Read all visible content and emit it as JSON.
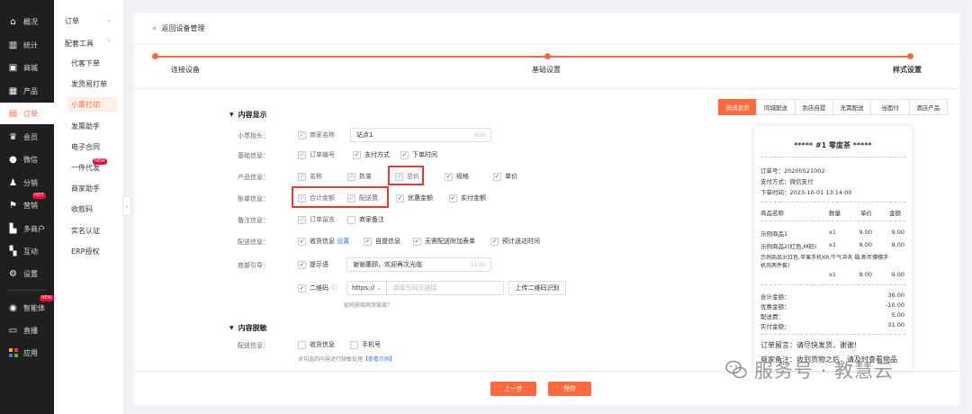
{
  "nav": {
    "items": [
      {
        "label": "概况",
        "icon": "home-icon"
      },
      {
        "label": "统计",
        "icon": "chart-icon"
      },
      {
        "label": "商城",
        "icon": "shop-icon"
      },
      {
        "label": "产品",
        "icon": "grid-icon"
      },
      {
        "label": "订单",
        "icon": "order-icon",
        "active": true
      },
      {
        "label": "会员",
        "icon": "crown-icon"
      },
      {
        "label": "微信",
        "icon": "wechat-icon"
      },
      {
        "label": "分销",
        "icon": "user-share-icon"
      },
      {
        "label": "营销",
        "icon": "flag-icon",
        "badge": "HOT"
      },
      {
        "label": "多商户",
        "icon": "store-icon"
      },
      {
        "label": "互动",
        "icon": "interaction-icon"
      },
      {
        "label": "设置",
        "icon": "gear-icon"
      },
      {
        "label": "智能体",
        "icon": "robot-icon",
        "badge": "NEW"
      },
      {
        "label": "直播",
        "icon": "tv-icon"
      },
      {
        "label": "应用",
        "icon": "apps-icon"
      }
    ]
  },
  "subnav": {
    "group_order": "订单",
    "group_tools": "配套工具",
    "items": [
      {
        "label": "代客下单"
      },
      {
        "label": "发货易打单"
      },
      {
        "label": "小票打印",
        "active": true
      },
      {
        "label": "发票助手"
      },
      {
        "label": "电子合同"
      },
      {
        "label": "一件代发",
        "badge": "NEW"
      },
      {
        "label": "商家助手"
      },
      {
        "label": "收款码"
      },
      {
        "label": "实名认证"
      },
      {
        "label": "ERP授权"
      }
    ]
  },
  "header": {
    "back_label": "返回设备管理"
  },
  "steps": [
    "连接设备",
    "基础设置",
    "样式设置"
  ],
  "form": {
    "section_display": "内容显示",
    "section_mask": "内容脱敏",
    "ticket_header": {
      "label": "小票抬头：",
      "checkbox": "商家名称",
      "value": "站点1",
      "count": "3/30"
    },
    "basic": {
      "label": "基础信息：",
      "items": [
        "订单编号",
        "支付方式",
        "下单时间"
      ]
    },
    "product": {
      "label": "产品信息：",
      "items": [
        "名称",
        "数量",
        "总价",
        "规格",
        "单价"
      ]
    },
    "bill": {
      "label": "账单信息：",
      "items": [
        "合计金额",
        "配送费",
        "优惠金额",
        "实付金额"
      ]
    },
    "remark": {
      "label": "备注信息：",
      "items": [
        "订单留言",
        "商家备注"
      ]
    },
    "delivery": {
      "label": "配送信息：",
      "items": [
        "收货信息",
        "自提信息",
        "无需配送附加表单",
        "预计送达时间"
      ],
      "settings_link": "设置"
    },
    "footer": {
      "label": "底部引导：",
      "prompt_checkbox": "提示语",
      "prompt_value": "谢谢惠顾，欢迎再次光临",
      "prompt_count": "11/20",
      "qr_checkbox": "二维码",
      "protocol": "https://",
      "url_placeholder": "请填写网页链接",
      "upload_btn": "上传二维码识别",
      "howto_link": "如何获取网页链接？"
    },
    "mask": {
      "label": "配送信息：",
      "items": [
        "收货信息",
        "手机号"
      ],
      "hint": "对勾选的内容进行脱敏处理",
      "example_link": "【查看示例】"
    }
  },
  "buttons": {
    "prev": "上一步",
    "save": "保存"
  },
  "preview": {
    "tabs": [
      "快递发货",
      "同城配送",
      "到店自提",
      "无需配送",
      "当面付",
      "酒店产品"
    ],
    "title": "***** #1  零度茶 *****",
    "order_no": "订单号：20200521002",
    "pay_method": "支付方式：微信支付",
    "order_time": "下单时间：2023-10-01 13:14:00",
    "columns": [
      "商品名称",
      "数量",
      "单价",
      "金额"
    ],
    "rows": [
      {
        "name": "示例商品1",
        "qty": "x1",
        "price": "9.00",
        "amount": "9.00"
      },
      {
        "name": "示例商品2(红色,M码)",
        "qty": "x1",
        "price": "9.00",
        "amount": "9.00"
      },
      {
        "name": "示例商品3(红色,苹果手机XR,牛气冲天 福,新年懵懵手机壳两件套)",
        "name1": "示例商品3(红色,苹果手机XR,牛气冲天 福,新年懵懵手",
        "name2": "机壳两件套)",
        "qty": "x1",
        "price": "9.00",
        "amount": "9.00"
      }
    ],
    "totals": [
      {
        "label": "合计金额：",
        "value": "36.00"
      },
      {
        "label": "优惠金额：",
        "value": "-10.00"
      },
      {
        "label": "配送费：",
        "value": "5.00"
      },
      {
        "label": "实付金额：",
        "value": "31.00"
      }
    ],
    "message": "订单留言：请尽快发货，谢谢!",
    "merchant_note": "商家备注：收到货物之后，请及时查看物品"
  },
  "watermark": {
    "text": "服务号 · 教慧云"
  },
  "colors": {
    "accent": "#ff6a3d",
    "highlight": "#e8392f",
    "nav_bg": "#1f1f1f",
    "link": "#2f7cf6"
  }
}
